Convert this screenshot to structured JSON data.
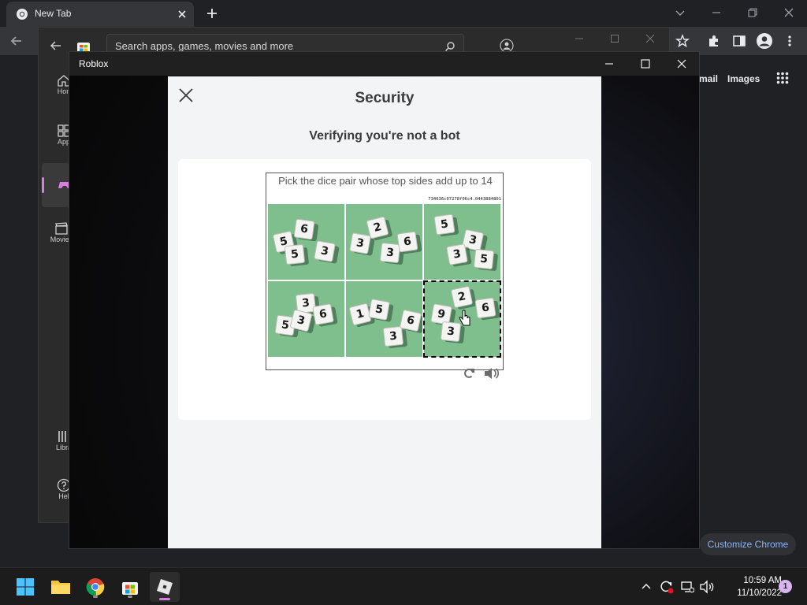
{
  "chrome": {
    "tab_title": "New Tab",
    "links": {
      "gmail": "mail",
      "images": "Images"
    },
    "customize_label": "Customize Chrome"
  },
  "store": {
    "search_placeholder": "Search apps, games, movies and more",
    "nav": {
      "home": "Hon",
      "apps": "App",
      "movies": "Movies",
      "library": "Libra",
      "help": "Hel"
    }
  },
  "roblox": {
    "window_title": "Roblox"
  },
  "security": {
    "title": "Security",
    "subtitle": "Verifying you're not a bot",
    "captcha": {
      "prompt": "Pick the dice pair whose top sides add up to 14",
      "challenge_id": "734636c07278f06c4.0443884801",
      "selected_tile": 6,
      "tiles": [
        {
          "dice": [
            "5",
            "6",
            "5",
            "3"
          ]
        },
        {
          "dice": [
            "3",
            "2",
            "3",
            "6"
          ]
        },
        {
          "dice": [
            "5",
            "3",
            "3",
            "5"
          ]
        },
        {
          "dice": [
            "5",
            "3",
            "3",
            "6"
          ]
        },
        {
          "dice": [
            "1",
            "5",
            "3",
            "6"
          ]
        },
        {
          "dice": [
            "9",
            "2",
            "3",
            "6"
          ]
        }
      ]
    }
  },
  "taskbar": {
    "time": "10:59 AM",
    "date": "11/10/2022",
    "notification_count": "1"
  },
  "colors": {
    "chrome_bg": "#202124",
    "dialog_bg": "#f2f4f5",
    "tile_green": "#7fbf8d",
    "link_blue": "#8ab4f8"
  }
}
